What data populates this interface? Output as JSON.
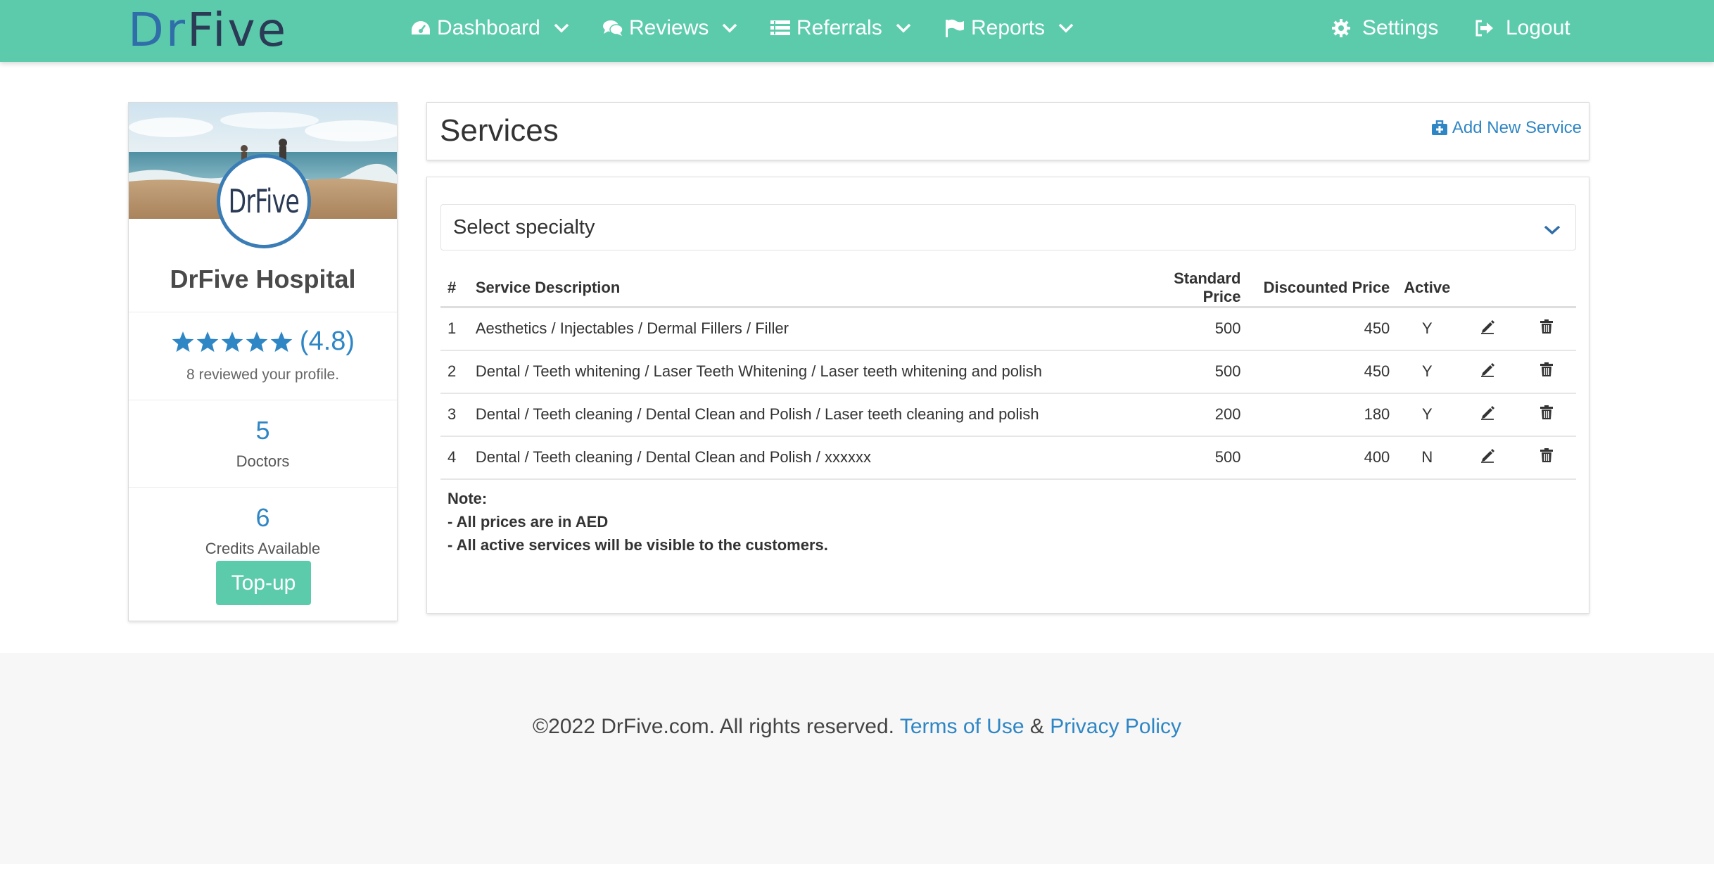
{
  "brand": {
    "part1": "Dr",
    "part2": "Five"
  },
  "nav": {
    "dashboard": "Dashboard",
    "reviews": "Reviews",
    "referrals": "Referrals",
    "reports": "Reports",
    "settings": "Settings",
    "logout": "Logout"
  },
  "profile": {
    "avatar_text": "DrFive",
    "name": "DrFive Hospital",
    "rating": "(4.8)",
    "stars": 5,
    "reviewed": "8 reviewed your profile.",
    "doctors_count": "5",
    "doctors_label": "Doctors",
    "credits_count": "6",
    "credits_label": "Credits Available",
    "topup_label": "Top-up"
  },
  "services": {
    "title": "Services",
    "add_label": "Add New Service",
    "select_placeholder": "Select specialty",
    "columns": {
      "num": "#",
      "description": "Service Description",
      "standard_price": "Standard Price",
      "discounted_price": "Discounted Price",
      "active": "Active"
    },
    "rows": [
      {
        "num": "1",
        "description": "Aesthetics / Injectables / Dermal Fillers / Filler",
        "standard": "500",
        "discounted": "450",
        "active": "Y"
      },
      {
        "num": "2",
        "description": "Dental / Teeth whitening / Laser Teeth Whitening / Laser teeth whitening and polish",
        "standard": "500",
        "discounted": "450",
        "active": "Y"
      },
      {
        "num": "3",
        "description": "Dental / Teeth cleaning / Dental Clean and Polish / Laser teeth cleaning and polish",
        "standard": "200",
        "discounted": "180",
        "active": "Y"
      },
      {
        "num": "4",
        "description": "Dental / Teeth cleaning / Dental Clean and Polish / xxxxxx",
        "standard": "500",
        "discounted": "400",
        "active": "N"
      }
    ],
    "note_title": "Note:",
    "note_line1": "- All prices are in AED",
    "note_line2": "- All active services will be visible to the customers."
  },
  "footer": {
    "copyright": "©2022 DrFive.com. All rights reserved.",
    "terms": "Terms of Use",
    "amp": "&",
    "privacy": "Privacy Policy"
  },
  "colors": {
    "navbar": "#5ccbac",
    "accent_blue": "#2f86c4",
    "topup": "#5ccbac"
  }
}
